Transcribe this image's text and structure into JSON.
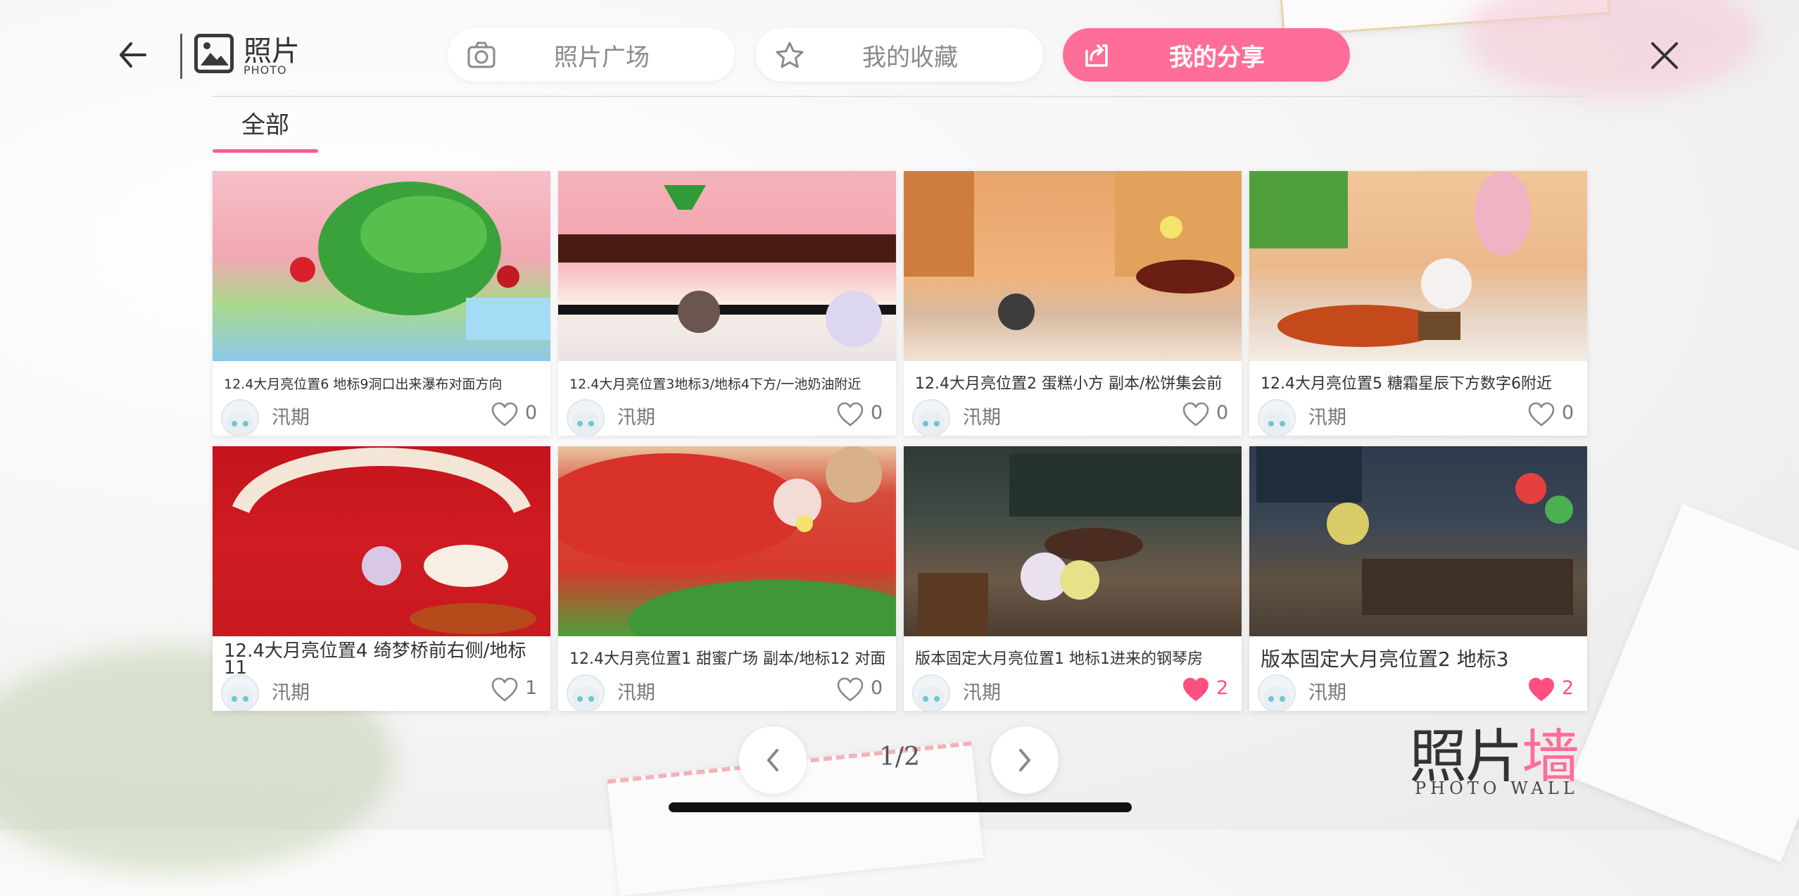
{
  "header": {
    "title": "照片",
    "subtitle": "PHOTO"
  },
  "tabs": [
    {
      "label": "照片广场",
      "icon": "camera-icon",
      "active": false
    },
    {
      "label": "我的收藏",
      "icon": "star-icon",
      "active": false
    },
    {
      "label": "我的分享",
      "icon": "share-icon",
      "active": true
    }
  ],
  "filter": {
    "label": "全部"
  },
  "photos": [
    {
      "caption": "12.4大月亮位置6 地标9洞口出来瀑布对面方向",
      "author": "汛期",
      "likes": "0",
      "liked": false
    },
    {
      "caption": "12.4大月亮位置3地标3/地标4下方/一池奶油附近",
      "author": "汛期",
      "likes": "0",
      "liked": false
    },
    {
      "caption": "12.4大月亮位置2 蛋糕小方 副本/松饼集会前",
      "author": "汛期",
      "likes": "0",
      "liked": false
    },
    {
      "caption": "12.4大月亮位置5 糖霜星辰下方数字6附近",
      "author": "汛期",
      "likes": "0",
      "liked": false
    },
    {
      "caption": "12.4大月亮位置4 绮梦桥前右侧/地标11",
      "author": "汛期",
      "likes": "1",
      "liked": false
    },
    {
      "caption": "12.4大月亮位置1 甜蜜广场 副本/地标12 对面",
      "author": "汛期",
      "likes": "0",
      "liked": false
    },
    {
      "caption": "版本固定大月亮位置1 地标1进来的钢琴房",
      "author": "汛期",
      "likes": "2",
      "liked": true
    },
    {
      "caption": "版本固定大月亮位置2 地标3",
      "author": "汛期",
      "likes": "2",
      "liked": true
    }
  ],
  "pagination": {
    "label": "1/2"
  },
  "watermark": {
    "title_a": "照片",
    "title_b": "墙",
    "subtitle": "PHOTO WALL"
  },
  "colors": {
    "accent": "#ff6e98",
    "liked": "#ff4f7f"
  }
}
